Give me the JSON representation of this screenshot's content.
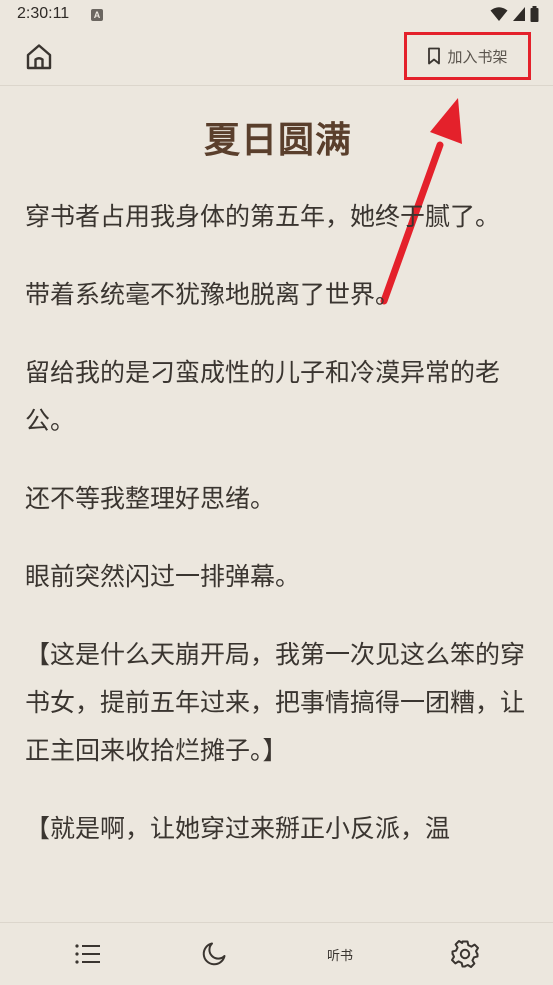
{
  "status_bar": {
    "time": "2:30:11",
    "notification_icon": "a-icon",
    "icons": [
      "wifi-icon",
      "signal-icon",
      "battery-icon"
    ]
  },
  "topbar": {
    "home_icon": "home-icon",
    "shelf_label": "加入书架",
    "shelf_icon": "bookmark-icon"
  },
  "chapter": {
    "title": "夏日圆满",
    "paragraphs": [
      "穿书者占用我身体的第五年，她终于腻了。",
      "带着系统毫不犹豫地脱离了世界。",
      "留给我的是刁蛮成性的儿子和冷漠异常的老公。",
      "还不等我整理好思绪。",
      "眼前突然闪过一排弹幕。",
      "【这是什么天崩开局，我第一次见这么笨的穿书女，提前五年过来，把事情搞得一团糟，让正主回来收拾烂摊子。】",
      "【就是啊，让她穿过来掰正小反派，温"
    ]
  },
  "bottom_bar": {
    "toc_icon": "list-icon",
    "night_icon": "moon-icon",
    "listen_label": "听书",
    "settings_icon": "gear-icon"
  },
  "annotation": {
    "highlight_color": "#e4212b"
  }
}
